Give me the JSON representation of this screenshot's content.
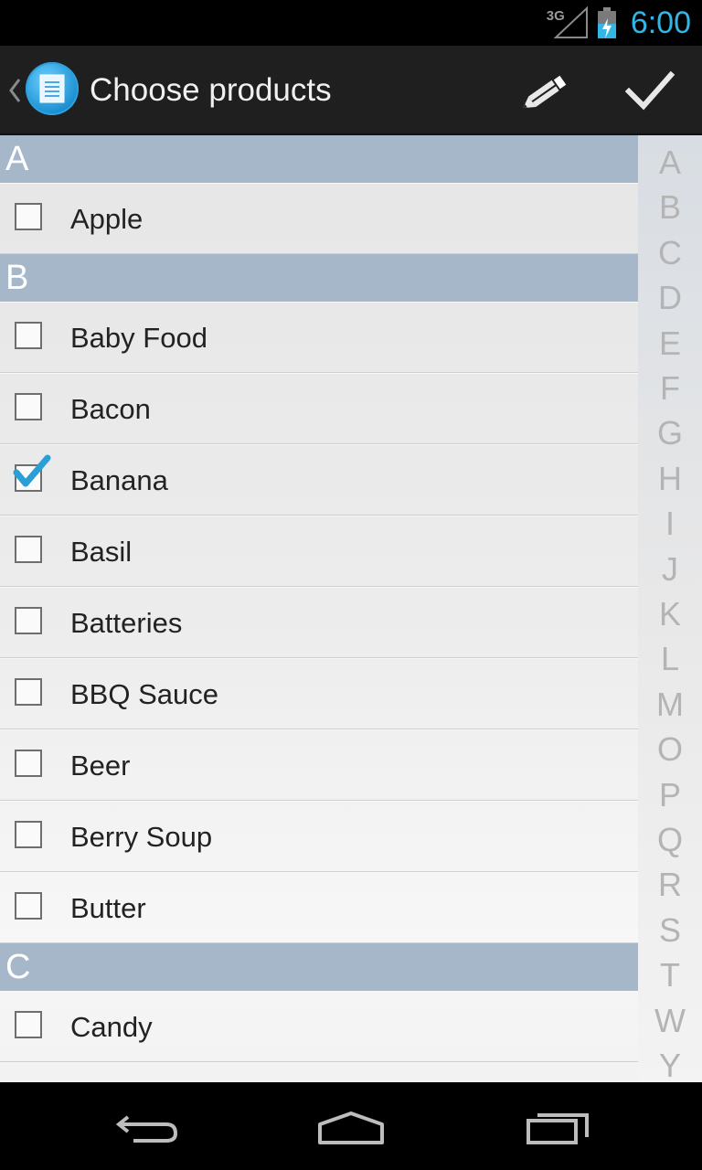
{
  "status_bar": {
    "network": "3G",
    "time": "6:00",
    "battery_level": 0.55
  },
  "action_bar": {
    "title": "Choose products",
    "app_icon": "notepad-icon",
    "actions": [
      "pencil-icon",
      "checkmark-icon"
    ]
  },
  "sections": [
    {
      "letter": "A",
      "items": [
        {
          "label": "Apple",
          "checked": false
        }
      ]
    },
    {
      "letter": "B",
      "items": [
        {
          "label": "Baby Food",
          "checked": false
        },
        {
          "label": "Bacon",
          "checked": false
        },
        {
          "label": "Banana",
          "checked": true
        },
        {
          "label": "Basil",
          "checked": false
        },
        {
          "label": "Batteries",
          "checked": false
        },
        {
          "label": "BBQ Sauce",
          "checked": false
        },
        {
          "label": "Beer",
          "checked": false
        },
        {
          "label": "Berry Soup",
          "checked": false
        },
        {
          "label": "Butter",
          "checked": false
        }
      ]
    },
    {
      "letter": "C",
      "items": [
        {
          "label": "Candy",
          "checked": false
        }
      ]
    }
  ],
  "index_letters": [
    "A",
    "B",
    "C",
    "D",
    "E",
    "F",
    "G",
    "H",
    "I",
    "J",
    "K",
    "L",
    "M",
    "O",
    "P",
    "Q",
    "R",
    "S",
    "T",
    "W",
    "Y"
  ],
  "colors": {
    "accent": "#33b5e5",
    "section_header": "#a7b7ca",
    "action_bar": "#1f1f1f"
  },
  "nav_bar": [
    "back-icon",
    "home-icon",
    "recent-apps-icon"
  ]
}
